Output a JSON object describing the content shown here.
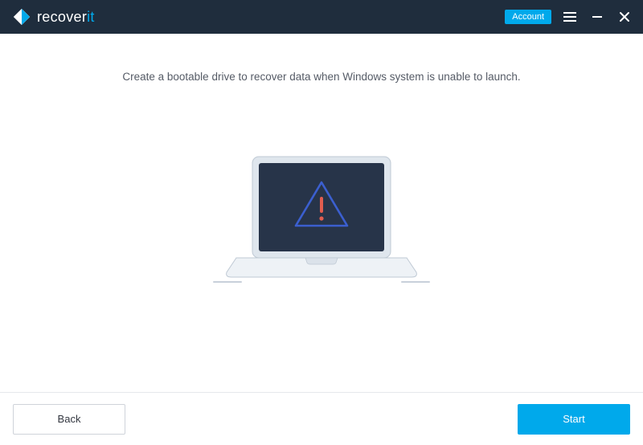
{
  "app": {
    "name_prefix": "recover",
    "name_accent": "it"
  },
  "titlebar": {
    "account_label": "Account"
  },
  "main": {
    "headline": "Create a bootable drive to recover data when Windows system is unable to launch."
  },
  "footer": {
    "back_label": "Back",
    "start_label": "Start"
  },
  "colors": {
    "header_bg": "#1f2d3d",
    "accent": "#00a9eb",
    "laptop_screen": "#273449",
    "laptop_body": "#dfe6ed",
    "laptop_stroke": "#bfc9d4",
    "triangle": "#3b5fcf",
    "exclaim": "#e15d4f"
  }
}
